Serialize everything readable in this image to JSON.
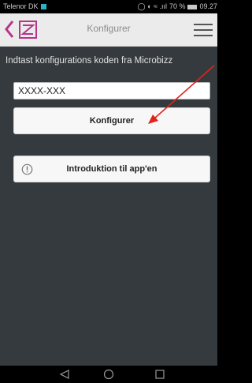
{
  "status_bar": {
    "carrier": "Telenor DK",
    "signal_battery": "70 %",
    "time": "09.27"
  },
  "header": {
    "title": "Konfigurer",
    "back_icon": "chevron-left-icon",
    "logo_icon": "z-logo-icon",
    "menu_icon": "hamburger-menu-icon"
  },
  "main": {
    "prompt": "Indtast konfigurations koden fra Microbizz",
    "code_input_value": "XXXX-XXX",
    "configure_label": "Konfigurer",
    "intro_label": "Introduktion til app'en",
    "intro_icon": "info-circle-icon"
  },
  "colors": {
    "background": "#343a3d",
    "header_bg": "#ebebeb",
    "accent_purple": "#b7348a",
    "annotation_red": "#e0231b"
  },
  "nav_bar": {
    "back_icon": "triangle-back-icon",
    "home_icon": "circle-home-icon",
    "recent_icon": "square-recent-icon"
  }
}
